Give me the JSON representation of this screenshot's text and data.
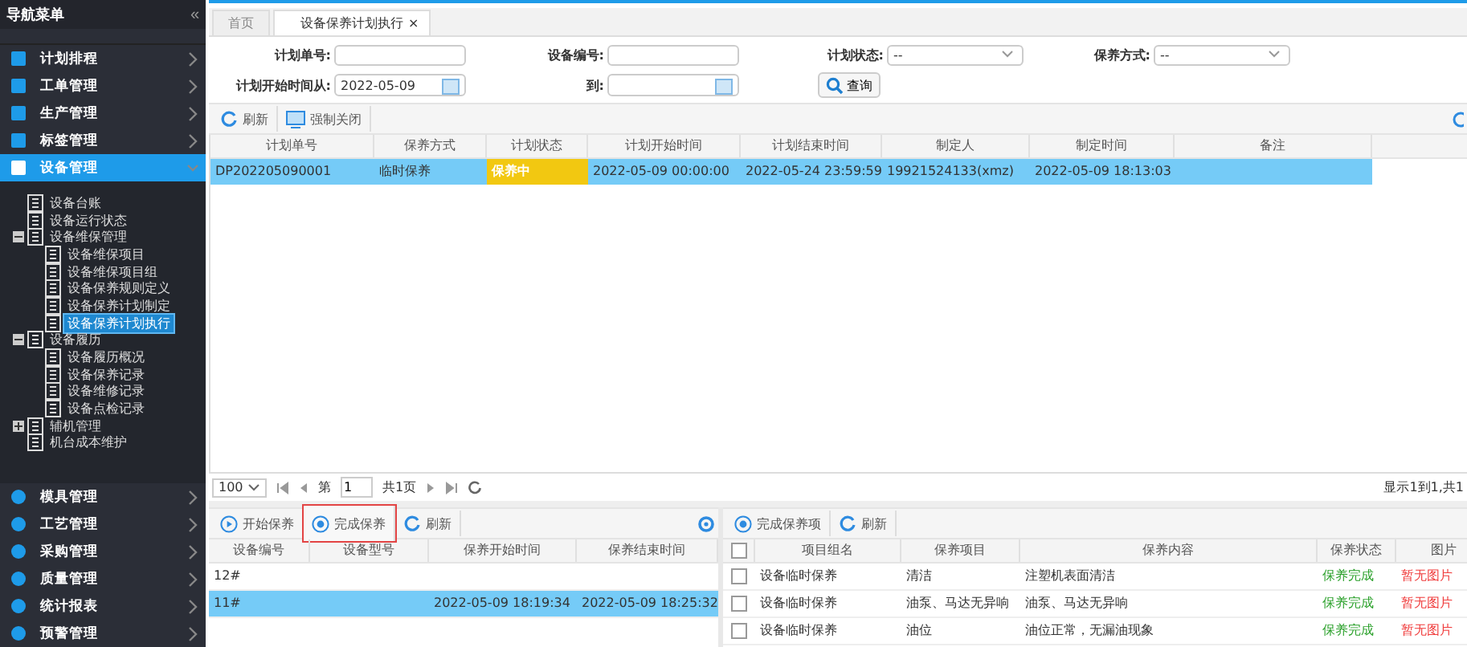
{
  "sidebar": {
    "title": "导航菜单",
    "collapse_glyph": "«",
    "items": [
      {
        "label": "计划排程",
        "selected": false,
        "expanded": false
      },
      {
        "label": "工单管理",
        "selected": false,
        "expanded": false
      },
      {
        "label": "生产管理",
        "selected": false,
        "expanded": false
      },
      {
        "label": "标签管理",
        "selected": false,
        "expanded": false
      },
      {
        "label": "设备管理",
        "selected": true,
        "expanded": true,
        "children": [
          {
            "label": "设备台账",
            "selected": false
          },
          {
            "label": "设备运行状态",
            "selected": false
          },
          {
            "label": "设备维保管理",
            "selected": false,
            "expanded": true,
            "children": [
              {
                "label": "设备维保项目",
                "selected": false
              },
              {
                "label": "设备维保项目组",
                "selected": false
              },
              {
                "label": "设备保养规则定义",
                "selected": false
              },
              {
                "label": "设备保养计划制定",
                "selected": false
              },
              {
                "label": "设备保养计划执行",
                "selected": true
              }
            ]
          },
          {
            "label": "设备履历",
            "selected": false,
            "expanded": true,
            "children": [
              {
                "label": "设备履历概况",
                "selected": false
              },
              {
                "label": "设备保养记录",
                "selected": false
              },
              {
                "label": "设备维修记录",
                "selected": false
              },
              {
                "label": "设备点检记录",
                "selected": false
              }
            ]
          },
          {
            "label": "辅机管理",
            "selected": false,
            "expanded": false
          },
          {
            "label": "机台成本维护",
            "selected": false
          }
        ]
      },
      {
        "label": "模具管理",
        "selected": false,
        "expanded": false
      },
      {
        "label": "工艺管理",
        "selected": false,
        "expanded": false
      },
      {
        "label": "采购管理",
        "selected": false,
        "expanded": false
      },
      {
        "label": "质量管理",
        "selected": false,
        "expanded": false
      },
      {
        "label": "统计报表",
        "selected": false,
        "expanded": false
      },
      {
        "label": "预警管理",
        "selected": false,
        "expanded": false
      }
    ]
  },
  "tabs": [
    {
      "label": "首页",
      "selected": false
    },
    {
      "label": "设备保养计划执行",
      "selected": true,
      "close_glyph": "×"
    }
  ],
  "filters": {
    "plan_no": {
      "label": "计划单号:"
    },
    "device_no": {
      "label": "设备编号:"
    },
    "plan_status": {
      "label": "计划状态:",
      "value": "--"
    },
    "method": {
      "label": "保养方式:",
      "value": "--"
    },
    "start_from": {
      "label": "计划开始时间从:",
      "value": "2022-05-09"
    },
    "start_to": {
      "label": "到:"
    },
    "query_button": "查询"
  },
  "toolbar": [
    "刷新",
    "强制关闭"
  ],
  "plan_table": {
    "columns": [
      "计划单号",
      "保养方式",
      "计划状态",
      "计划开始时间",
      "计划结束时间",
      "制定人",
      "制定时间",
      "备注"
    ],
    "rows": [
      {
        "selected": true,
        "cells": [
          "DP202205090001",
          "临时保养",
          "保养中",
          "2022-05-09 00:00:00",
          "2022-05-24 23:59:59",
          "19921524133(xmz)",
          "2022-05-09 18:13:03",
          ""
        ]
      }
    ]
  },
  "pager": {
    "page_size": "100",
    "page_label_before": "第",
    "page": "1",
    "page_label_after": "共1页",
    "summary": "显示1到1,共1"
  },
  "device_panel": {
    "toolbar": [
      {
        "label": "开始保养",
        "highlighted": false
      },
      {
        "label": "完成保养",
        "highlighted": true
      },
      {
        "label": "刷新",
        "highlighted": false,
        "kind": "refresh"
      }
    ],
    "columns": [
      "设备编号",
      "设备型号",
      "保养开始时间",
      "保养结束时间"
    ],
    "rows": [
      {
        "selected": false,
        "cells": [
          "12#",
          "",
          "",
          ""
        ]
      },
      {
        "selected": true,
        "cells": [
          "11#",
          "",
          "2022-05-09 18:19:34",
          "2022-05-09 18:25:32"
        ]
      }
    ]
  },
  "item_panel": {
    "toolbar": [
      {
        "label": "完成保养项",
        "kind": "complete"
      },
      {
        "label": "刷新",
        "kind": "refresh"
      }
    ],
    "select_all_checked": false,
    "columns": [
      "项目组名",
      "保养项目",
      "保养内容",
      "保养状态",
      "图片"
    ],
    "rows": [
      {
        "checked": false,
        "cells": [
          "设备临时保养",
          "清洁",
          "注塑机表面清洁",
          "保养完成",
          "暂无图片"
        ]
      },
      {
        "checked": false,
        "cells": [
          "设备临时保养",
          "油泵、马达无异响",
          "油泵、马达无异响",
          "保养完成",
          "暂无图片"
        ]
      },
      {
        "checked": false,
        "cells": [
          "设备临时保养",
          "油位",
          "油位正常，无漏油现象",
          "保养完成",
          "暂无图片"
        ]
      }
    ]
  }
}
